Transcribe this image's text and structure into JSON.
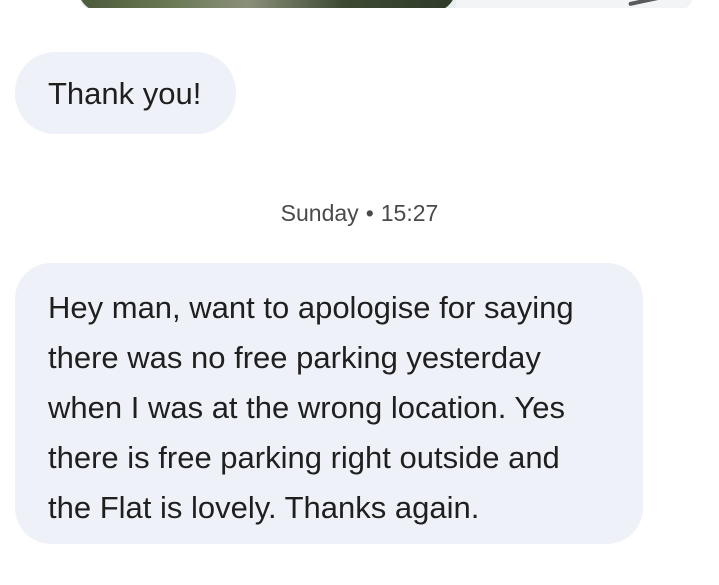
{
  "conversation": {
    "messages": [
      {
        "type": "image",
        "content": ""
      },
      {
        "type": "text",
        "text": "Thank you!"
      },
      {
        "type": "timestamp",
        "day": "Sunday",
        "separator": "•",
        "time": "15:27"
      },
      {
        "type": "text",
        "text": "Hey man, want to apologise for saying\nthere was no free parking  yesterday\nwhen I was at the wrong location. Yes\nthere is free parking right outside and\nthe Flat is lovely. Thanks again."
      }
    ]
  }
}
